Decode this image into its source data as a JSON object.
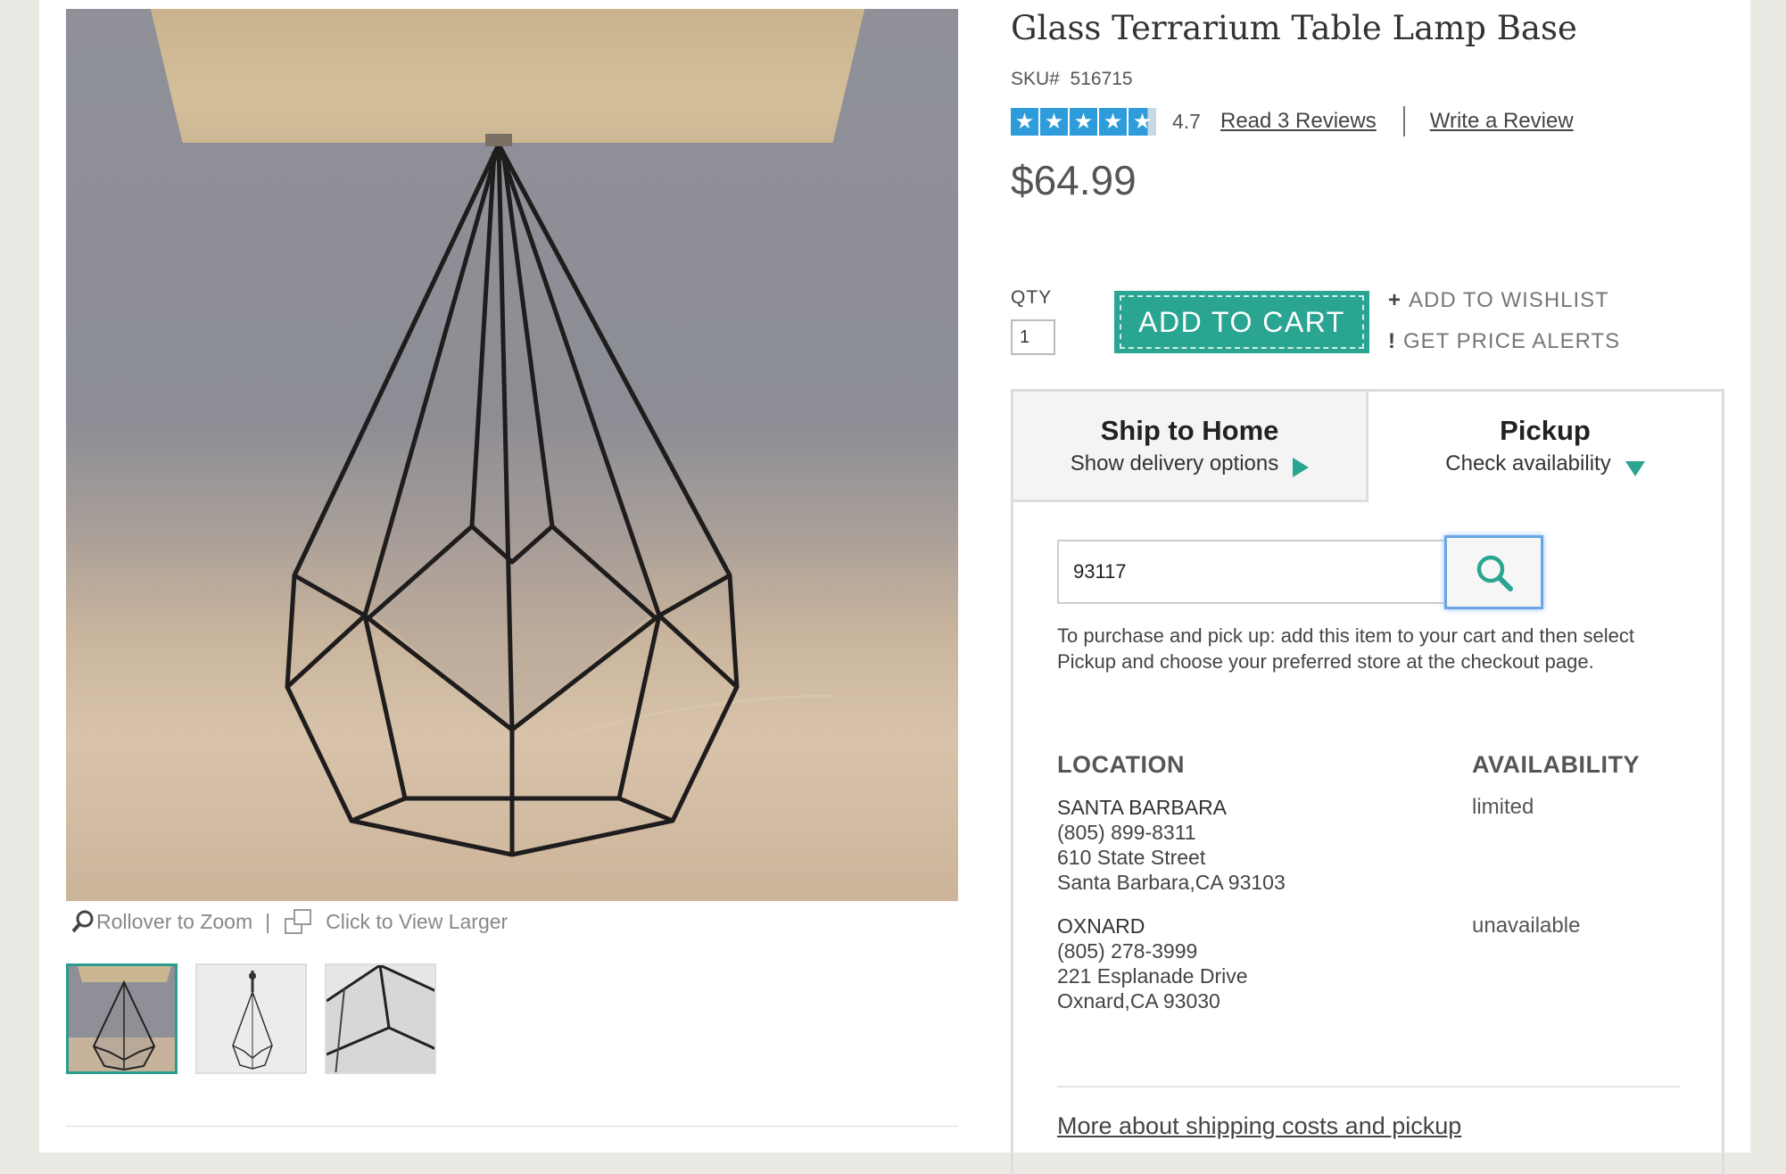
{
  "product": {
    "title": "Glass Terrarium Table Lamp Base",
    "sku_label": "SKU#",
    "sku": "516715",
    "rating": "4.7",
    "rating_stars": 4.7,
    "read_reviews": "Read 3 Reviews",
    "write_review": "Write a Review",
    "price": "$64.99"
  },
  "gallery": {
    "rollover": "Rollover to Zoom",
    "separator": "|",
    "click_larger": "Click to View Larger",
    "thumbnails": [
      "lamp-with-shade",
      "lamp-base-only",
      "glass-detail"
    ]
  },
  "purchase": {
    "qty_label": "QTY",
    "qty_value": "1",
    "add_to_cart": "ADD TO CART",
    "wishlist_symbol": "+",
    "wishlist": "ADD TO WISHLIST",
    "alerts_symbol": "!",
    "alerts": "GET PRICE ALERTS"
  },
  "shipping": {
    "tab_home_title": "Ship to Home",
    "tab_home_sub": "Show delivery options",
    "tab_pickup_title": "Pickup",
    "tab_pickup_sub": "Check availability",
    "zip_value": "93117",
    "note": "To purchase and pick up: add this item to your cart and then select Pickup and choose your preferred store at the checkout page.",
    "location_header": "LOCATION",
    "availability_header": "AVAILABILITY",
    "stores": [
      {
        "name": "SANTA BARBARA",
        "phone": "(805) 899-8311",
        "street": "610 State Street",
        "city": "Santa Barbara,CA 93103",
        "availability": "limited"
      },
      {
        "name": "OXNARD",
        "phone": "(805) 278-3999",
        "street": "221 Esplanade Drive",
        "city": "Oxnard,CA 93030",
        "availability": "unavailable"
      }
    ],
    "more_link": "More about shipping costs and pickup"
  },
  "colors": {
    "accent": "#2aa592",
    "star": "#2e9cdb",
    "search_focus": "#6aa6e6"
  }
}
